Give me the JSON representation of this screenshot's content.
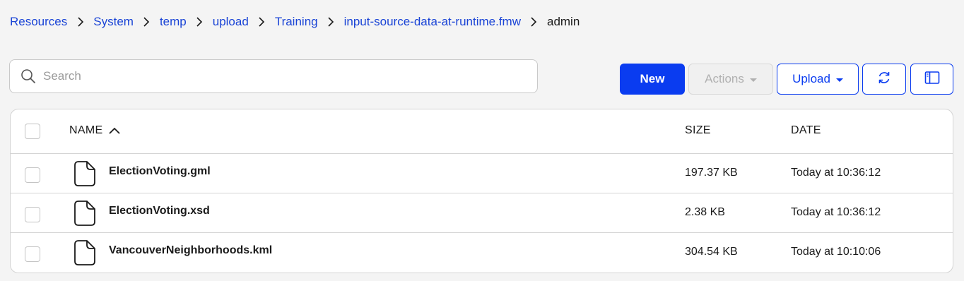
{
  "breadcrumb": {
    "items": [
      "Resources",
      "System",
      "temp",
      "upload",
      "Training",
      "input-source-data-at-runtime.fmw"
    ],
    "current": "admin"
  },
  "search": {
    "placeholder": "Search",
    "value": "",
    "icon": "search-icon"
  },
  "toolbar": {
    "new_label": "New",
    "actions_label": "Actions",
    "actions_enabled": false,
    "upload_label": "Upload",
    "refresh_icon": "refresh-icon",
    "columns_icon": "columns-icon"
  },
  "table": {
    "columns": {
      "name": "NAME",
      "size": "SIZE",
      "date": "DATE"
    },
    "sort": {
      "column": "name",
      "direction": "ascending"
    },
    "rows": [
      {
        "name": "ElectionVoting.gml",
        "size": "197.37 KB",
        "date": "Today at 10:36:12",
        "icon": "file-icon"
      },
      {
        "name": "ElectionVoting.xsd",
        "size": "2.38 KB",
        "date": "Today at 10:36:12",
        "icon": "file-icon"
      },
      {
        "name": "VancouverNeighborhoods.kml",
        "size": "304.54 KB",
        "date": "Today at 10:10:06",
        "icon": "file-icon"
      }
    ]
  },
  "colors": {
    "accent": "#0a3cf0",
    "link": "#1a44d6",
    "background": "#f4f4f4",
    "border": "#d4d4d4"
  }
}
